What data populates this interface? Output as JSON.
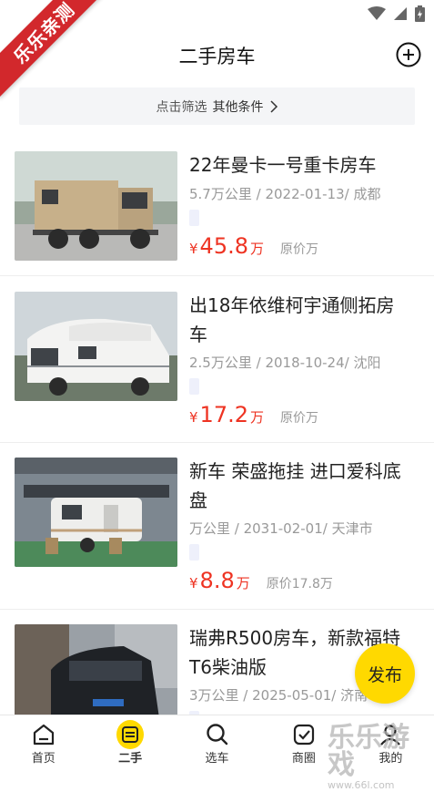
{
  "watermark": {
    "ribbon_text": "乐乐亲测",
    "corner_text": "乐乐游戏",
    "corner_url": "www.66l.com"
  },
  "header": {
    "title": "二手房车"
  },
  "filter": {
    "hint": "点击筛选",
    "other": "其他条件"
  },
  "listings": [
    {
      "title_line1": "22年曼卡一号重卡房车",
      "title_line2": "",
      "meta": "5.7万公里 / 2022-01-13/ 成都",
      "price_symbol": "¥",
      "price": "45.8",
      "price_unit": "万",
      "original_price": "原价万"
    },
    {
      "title_line1": "出18年依维柯宇通侧拓房",
      "title_line2": "车",
      "meta": "2.5万公里 / 2018-10-24/ 沈阳",
      "price_symbol": "¥",
      "price": "17.2",
      "price_unit": "万",
      "original_price": "原价万"
    },
    {
      "title_line1": "新车 荣盛拖挂 进口爱科底",
      "title_line2": "盘",
      "meta": "万公里 / 2031-02-01/ 天津市",
      "price_symbol": "¥",
      "price": "8.8",
      "price_unit": "万",
      "original_price": "原价17.8万"
    },
    {
      "title_line1": "瑞弗R500房车，新款福特",
      "title_line2": "T6柴油版",
      "meta": "3万公里 / 2025-05-01/ 济南",
      "price_symbol": "¥",
      "price": "",
      "price_unit": "",
      "original_price": ""
    }
  ],
  "fab": {
    "label": "发布"
  },
  "tabs": [
    {
      "label": "首页",
      "icon": "home-icon"
    },
    {
      "label": "二手",
      "icon": "swap-icon",
      "active": true
    },
    {
      "label": "选车",
      "icon": "search-icon"
    },
    {
      "label": "商圈",
      "icon": "check-shield-icon"
    },
    {
      "label": "我的",
      "icon": "person-icon"
    }
  ],
  "colors": {
    "accent": "#ffd900",
    "price": "#e32222",
    "ribbon": "#d2282c"
  }
}
